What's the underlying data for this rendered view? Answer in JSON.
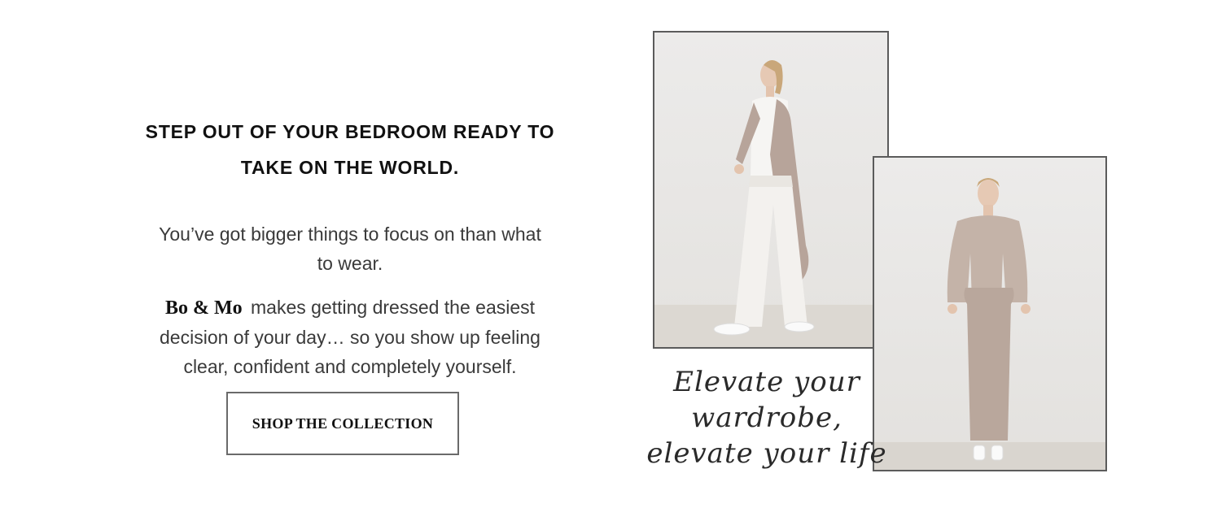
{
  "hero": {
    "headline_line1": "STEP OUT OF YOUR BEDROOM READY TO",
    "headline_line2": "TAKE ON THE WORLD.",
    "lead_line1": "You’ve got bigger things to focus on than what",
    "lead_line2": "to wear.",
    "brand_name": "Bo & Mo",
    "body_line1": "makes getting dressed the easiest",
    "body_line2": "decision of your day… so you show up feeling",
    "body_line3": "clear, confident and completely yourself.",
    "cta_label": "SHOP THE COLLECTION"
  },
  "tagline": {
    "line1": "Elevate your wardrobe,",
    "line2": "elevate your life"
  },
  "colors": {
    "background": "#ffffff",
    "frame_border": "#5b5b5b",
    "garment_taupe": "#b9a79c",
    "garment_white": "#f3f1ee"
  }
}
